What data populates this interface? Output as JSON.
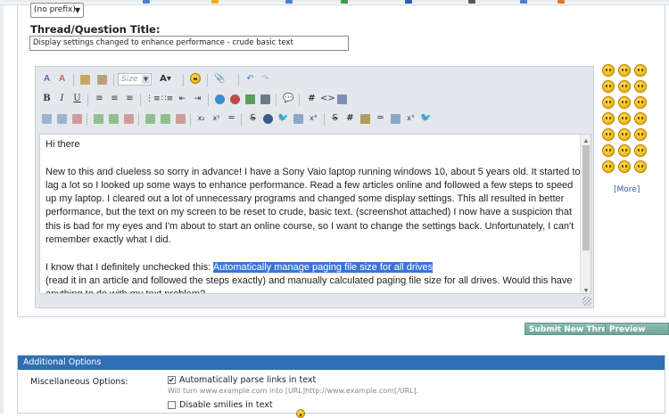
{
  "form": {
    "prefix_value": "(no prefix)",
    "title_label": "Thread/Question Title:",
    "title_value": "Display settings changed to enhance performance - crude basic text"
  },
  "toolbar": {
    "size_label": "Size",
    "font_label": "A",
    "bold": "B",
    "italic": "I",
    "underline": "U"
  },
  "editor_text": {
    "p1": "Hi there",
    "p2": "New to this and clueless so sorry in advance! I have a Sony Vaio laptop running windows 10, about 5 years old. It started to lag a lot so I looked up some ways to enhance performance. Read a few articles online and followed a few steps to speed up my laptop. I cleared out a lot of unnecessary programs and changed some display settings. This all resulted in better performance, but the text on my screen to be reset to crude, basic text. (screenshot attached) I now have a suspicion that this is bad for my eyes and I'm about to start an online course, so I want to change the settings back. Unfortunately, I can't remember exactly what I did.",
    "p3_before": "I know that I definitely unchecked this: ",
    "p3_highlight": "Automatically manage paging file size for all drives",
    "p3_after": "(read it in an article and followed the steps exactly) and manually calculated paging file size for all drives. Would this have anything to do with my text problem?"
  },
  "smilies": {
    "more_label": "[More]"
  },
  "buttons": {
    "submit": "Submit New Thread",
    "preview": "Preview Post"
  },
  "additional_options": {
    "header": "Additional Options",
    "misc_label": "Miscellaneous Options:",
    "parse_links_label": "Automatically parse links in text",
    "parse_links_checked": true,
    "parse_links_hint": "Will turn www.example.com into [URL]http://www.example.com[/URL].",
    "disable_smilies_label": "Disable smilies in text",
    "disable_smilies_checked": false
  },
  "colors": {
    "accent": "#2f6fb4",
    "button": "#7fb2a6",
    "selection": "#3875d7"
  }
}
